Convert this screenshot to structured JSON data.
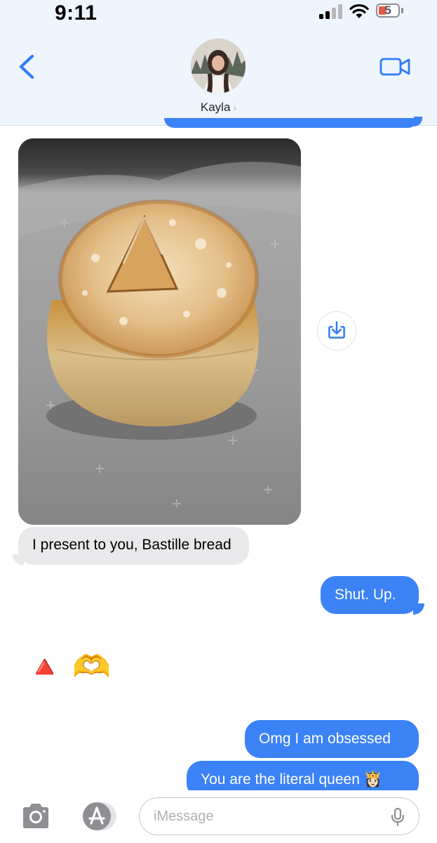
{
  "status_bar": {
    "time": "9:11",
    "battery_level": "5"
  },
  "header": {
    "contact_name": "Kayla",
    "chevron": "›"
  },
  "messages": {
    "incoming_caption": "I present to you, Bastille bread",
    "outgoing_1": "Shut. Up.",
    "emoji_reply": "🔺 🫶",
    "outgoing_2": "Omg I am obsessed",
    "outgoing_3": "You are the literal queen 👸🏻"
  },
  "compose": {
    "placeholder": "iMessage"
  },
  "icons": {
    "back": "chevron-left-icon",
    "video": "video-camera-icon",
    "download": "download-icon",
    "camera": "camera-icon",
    "apps": "app-store-icon",
    "mic": "microphone-icon"
  },
  "colors": {
    "accent": "#3b82f6",
    "incoming_bubble": "#e9e9eb",
    "header_bg": "#eef5fc",
    "battery_low": "#e25a46"
  }
}
